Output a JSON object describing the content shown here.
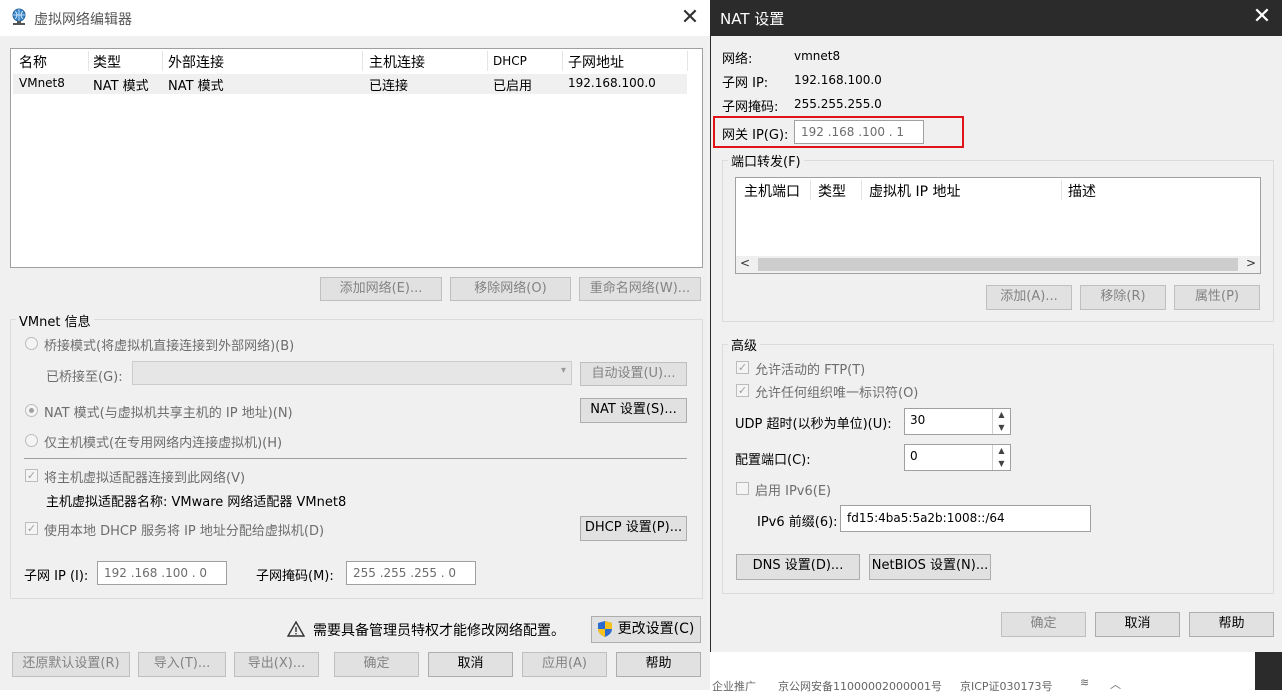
{
  "left_window": {
    "title": "虚拟网络编辑器",
    "table": {
      "headers": [
        "名称",
        "类型",
        "外部连接",
        "主机连接",
        "DHCP",
        "子网地址"
      ],
      "rows": [
        [
          "VMnet8",
          "NAT 模式",
          "NAT 模式",
          "已连接",
          "已启用",
          "192.168.100.0"
        ]
      ]
    },
    "list_buttons": {
      "add": "添加网络(E)...",
      "remove": "移除网络(O)",
      "rename": "重命名网络(W)..."
    },
    "info": {
      "group_label": "VMnet 信息",
      "bridged_label": "桥接模式(将虚拟机直接连接到外部网络)(B)",
      "bridged_to_label": "已桥接至(G):",
      "bridged_to_value": "",
      "auto_button": "自动设置(U)...",
      "nat_label": "NAT 模式(与虚拟机共享主机的 IP 地址)(N)",
      "nat_button": "NAT 设置(S)...",
      "host_only_label": "仅主机模式(在专用网络内连接虚拟机)(H)",
      "connect_adapter_label": "将主机虚拟适配器连接到此网络(V)",
      "adapter_name_label": "主机虚拟适配器名称: VMware 网络适配器 VMnet8",
      "dhcp_label": "使用本地 DHCP 服务将 IP 地址分配给虚拟机(D)",
      "dhcp_button": "DHCP 设置(P)...",
      "subnet_ip_label": "子网 IP (I):",
      "subnet_ip_value": "192 .168 .100 .  0",
      "subnet_mask_label": "子网掩码(M):",
      "subnet_mask_value": "255 .255 .255 .  0"
    },
    "admin_notice": "需要具备管理员特权才能修改网络配置。",
    "change_settings_button": "更改设置(C)",
    "footer_buttons": {
      "restore": "还原默认设置(R)",
      "import": "导入(T)...",
      "export": "导出(X)...",
      "ok": "确定",
      "cancel": "取消",
      "apply": "应用(A)",
      "help": "帮助"
    }
  },
  "nat_window": {
    "title": "NAT 设置",
    "network_label": "网络:",
    "network_value": "vmnet8",
    "subnet_ip_label": "子网 IP:",
    "subnet_ip_value": "192.168.100.0",
    "subnet_mask_label": "子网掩码:",
    "subnet_mask_value": "255.255.255.0",
    "gateway_label": "网关 IP(G):",
    "gateway_value": "192 .168 .100 .  1",
    "port_forwarding": {
      "group_label": "端口转发(F)",
      "headers": [
        "主机端口",
        "类型",
        "虚拟机 IP 地址",
        "描述"
      ],
      "add_button": "添加(A)...",
      "remove_button": "移除(R)",
      "properties_button": "属性(P)"
    },
    "advanced": {
      "group_label": "高级",
      "allow_ftp_label": "允许活动的 FTP(T)",
      "allow_uid_label": "允许任何组织唯一标识符(O)",
      "udp_timeout_label": "UDP 超时(以秒为单位)(U):",
      "udp_timeout_value": "30",
      "config_port_label": "配置端口(C):",
      "config_port_value": "0",
      "enable_ipv6_label": "启用 IPv6(E)",
      "ipv6_prefix_label": "IPv6 前缀(6):",
      "ipv6_prefix_value": "fd15:4ba5:5a2b:1008::/64",
      "dns_button": "DNS 设置(D)...",
      "netbios_button": "NetBIOS 设置(N)..."
    },
    "footer_buttons": {
      "ok": "确定",
      "cancel": "取消",
      "help": "帮助"
    }
  },
  "background_strip": {
    "text1": "企业推广",
    "text2": "京公网安备11000002000001号",
    "text3": "京ICP证030173号"
  },
  "colors": {
    "highlight_box": "#e0131b",
    "nat_titlebar": "#2b2b2b",
    "dialog_bg": "#f0f0f0"
  }
}
